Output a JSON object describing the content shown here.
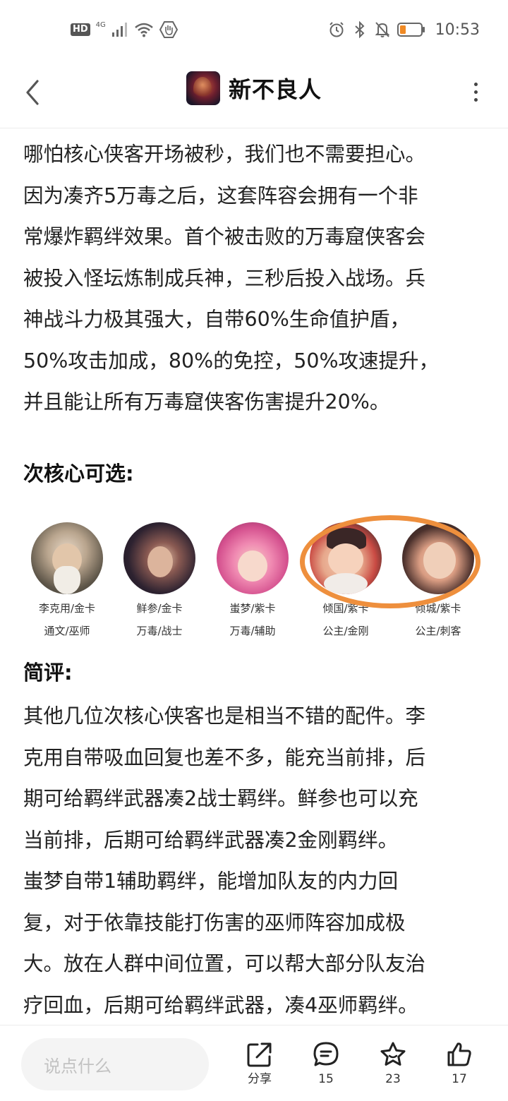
{
  "status_bar": {
    "hd": "HD",
    "network": "4G",
    "time": "10:53"
  },
  "header": {
    "title": "新不良人"
  },
  "article": {
    "paragraph1_lines": [
      "哪怕核心侠客开场被秒，我们也不需要担心。",
      "因为凑齐5万毒之后，这套阵容会拥有一个非",
      "常爆炸羁绊效果。首个被击败的万毒窟侠客会",
      "被投入怪坛炼制成兵神，三秒后投入战场。兵",
      "神战斗力极其强大，自带60%生命值护盾，",
      "50%攻击加成，80%的免控，50%攻速提升，",
      "并且能让所有万毒窟侠客伤害提升20%。"
    ],
    "section1_title": "次核心可选:",
    "heroes": [
      {
        "line1": "李克用/金卡",
        "line2": "通文/巫师"
      },
      {
        "line1": "鲜参/金卡",
        "line2": "万毒/战士"
      },
      {
        "line1": "蚩梦/紫卡",
        "line2": "万毒/辅助"
      },
      {
        "line1": "倾国/紫卡",
        "line2": "公主/金刚"
      },
      {
        "line1": "倾城/紫卡",
        "line2": "公主/刺客"
      }
    ],
    "section2_title": "简评:",
    "paragraph2_lines": [
      "其他几位次核心侠客也是相当不错的配件。李",
      "克用自带吸血回复也差不多，能充当前排，后",
      "期可给羁绊武器凑2战士羁绊。鲜参也可以充",
      "当前排，后期可给羁绊武器凑2金刚羁绊。",
      "蚩梦自带1辅助羁绊，能增加队友的内力回",
      "复，对于依靠技能打伤害的巫师阵容加成极",
      "大。放在人群中间位置，可以帮大部分队友治",
      "疗回血，后期可给羁绊武器，凑4巫师羁绊。"
    ]
  },
  "bottom_bar": {
    "comment_placeholder": "说点什么",
    "share_label": "分享",
    "comment_count": "15",
    "favorite_count": "23",
    "like_count": "17"
  },
  "colors": {
    "highlight": "#ee8f3d",
    "text": "#222222"
  }
}
